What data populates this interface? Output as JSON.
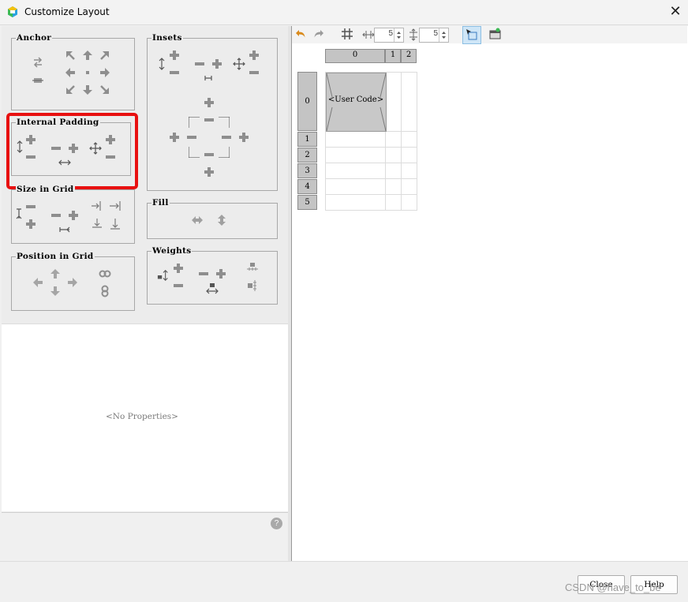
{
  "window": {
    "title": "Customize Layout"
  },
  "groups": {
    "anchor": "Anchor",
    "insets": "Insets",
    "internal_padding": "Internal Padding",
    "size_in_grid": "Size in Grid",
    "fill": "Fill",
    "position_in_grid": "Position in Grid",
    "weights": "Weights"
  },
  "properties": {
    "empty_text": "<No Properties>"
  },
  "toolbar": {
    "hgap_value": "5",
    "vgap_value": "5"
  },
  "grid": {
    "columns": [
      "0",
      "1",
      "2"
    ],
    "rows": [
      "0",
      "1",
      "2",
      "3",
      "4",
      "5"
    ],
    "component_label": "<User Code>"
  },
  "buttons": {
    "close": "Close",
    "help": "Help"
  },
  "watermark": "CSDN @have_to_be",
  "colors": {
    "highlight_box": "#e81010",
    "icon_gray": "#8e8e8e",
    "undo_orange": "#d98a1c",
    "select_tool_bg": "#cfe6f7"
  }
}
